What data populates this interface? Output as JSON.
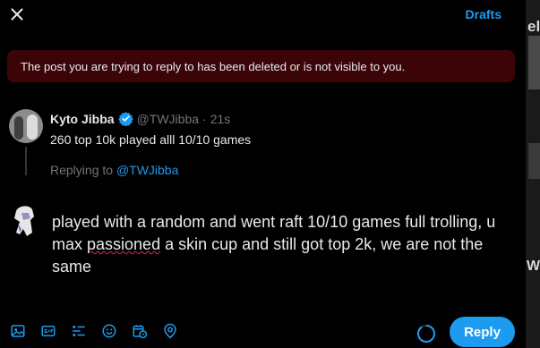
{
  "header": {
    "close_icon": "close-icon",
    "drafts_label": "Drafts"
  },
  "banner": {
    "message": "The post you are trying to reply to has been deleted or is not visible to you."
  },
  "original_post": {
    "author_name": "Kyto Jibba",
    "verified": true,
    "handle": "@TWJibba",
    "separator": "·",
    "time": "21s",
    "text": "260 top 10k played alll 10/10 games"
  },
  "replying": {
    "prefix": "Replying to",
    "mention": "@TWJibba"
  },
  "compose": {
    "text_before": "played with a random and went raft 10/10 games full trolling, u max ",
    "misspelled": "passioned",
    "text_after": " a skin cup and still got top 2k, we are not the same"
  },
  "toolbar": {
    "icons": [
      "image-icon",
      "gif-icon",
      "poll-icon",
      "emoji-icon",
      "schedule-icon",
      "location-icon"
    ],
    "reply_label": "Reply",
    "progress": 0.9
  },
  "colors": {
    "accent": "#1d9bf0",
    "banner_bg": "#3b0508",
    "background": "#000000"
  },
  "side_peek": {
    "top_text": "el",
    "bottom_text": "Wh"
  }
}
